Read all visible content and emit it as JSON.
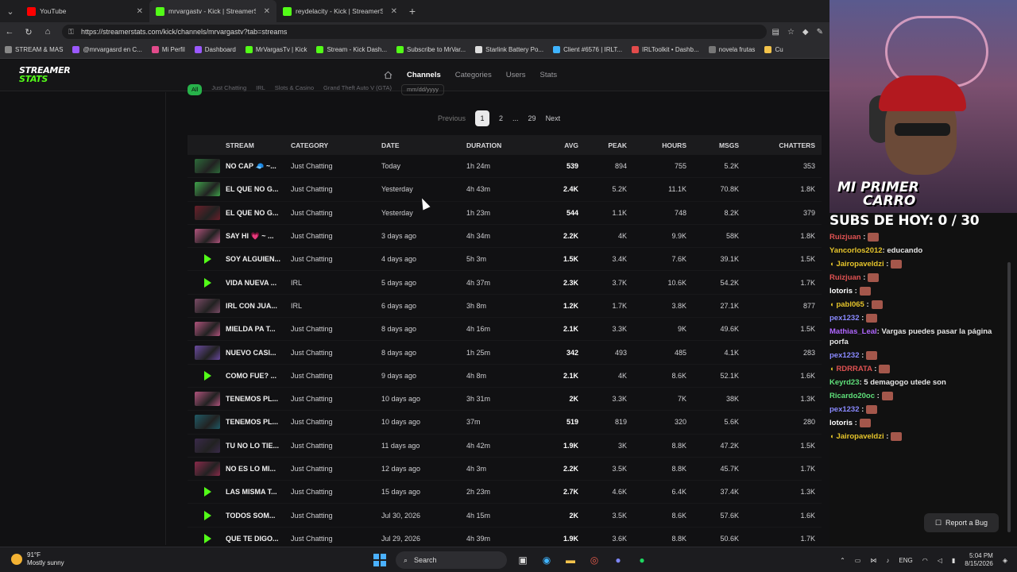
{
  "browser": {
    "tabs": [
      {
        "label": "YouTube",
        "fav_color": "#ff0000",
        "active": false
      },
      {
        "label": "mrvargastv - Kick | StreamerStats",
        "fav_color": "#53fc18",
        "active": true
      },
      {
        "label": "reydelacity - Kick | StreamerStats",
        "fav_color": "#53fc18",
        "active": false
      }
    ],
    "url": "https://streamerstats.com/kick/channels/mrvargastv?tab=streams",
    "bookmarks": [
      "STREAM & MAS",
      "@mrvargasrd en C...",
      "Mi Perfil",
      "Dashboard",
      "MrVargasTv | Kick",
      "Stream - Kick Dash...",
      "Subscribe to MrVar...",
      "Starlink Battery Po...",
      "Client #6576 | IRLT...",
      "IRLToolkit • Dashb...",
      "novela frutas",
      "Cu"
    ]
  },
  "site": {
    "logo_line1": "STREAMER",
    "logo_line2": "STATS",
    "nav": [
      "Channels",
      "Categories",
      "Users",
      "Stats"
    ],
    "filters": [
      "All",
      "Just Chatting",
      "IRL",
      "Slots & Casino",
      "Grand Theft Auto V (GTA)",
      "mm/dd/yyyy"
    ],
    "pagination": {
      "prev": "Previous",
      "pages": [
        "1",
        "2",
        "...",
        "29"
      ],
      "next": "Next"
    },
    "columns": [
      "STREAM",
      "CATEGORY",
      "DATE",
      "DURATION",
      "AVG",
      "PEAK",
      "HOURS",
      "MSGS",
      "CHATTERS"
    ],
    "rows": [
      {
        "name": "NO CAP 🧢 ~...",
        "category": "Just Chatting",
        "date": "Today",
        "duration": "1h 24m",
        "avg": "539",
        "peak": "894",
        "hours": "755",
        "msgs": "5.2K",
        "chatters": "353",
        "thumb": "img",
        "thumb_color": "#2d6b3a"
      },
      {
        "name": "EL QUE NO G...",
        "category": "Just Chatting",
        "date": "Yesterday",
        "duration": "4h 43m",
        "avg": "2.4K",
        "peak": "5.2K",
        "hours": "11.1K",
        "msgs": "70.8K",
        "chatters": "1.8K",
        "thumb": "img",
        "thumb_color": "#3fa24a"
      },
      {
        "name": "EL QUE NO G...",
        "category": "Just Chatting",
        "date": "Yesterday",
        "duration": "1h 23m",
        "avg": "544",
        "peak": "1.1K",
        "hours": "748",
        "msgs": "8.2K",
        "chatters": "379",
        "thumb": "img",
        "thumb_color": "#6b1f2a"
      },
      {
        "name": "SAY HI 💗 ~ ...",
        "category": "Just Chatting",
        "date": "3 days ago",
        "duration": "4h 34m",
        "avg": "2.2K",
        "peak": "4K",
        "hours": "9.9K",
        "msgs": "58K",
        "chatters": "1.8K",
        "thumb": "img",
        "thumb_color": "#b0537c"
      },
      {
        "name": "SOY ALGUIEN...",
        "category": "Just Chatting",
        "date": "4 days ago",
        "duration": "5h 3m",
        "avg": "1.5K",
        "peak": "3.4K",
        "hours": "7.6K",
        "msgs": "39.1K",
        "chatters": "1.5K",
        "thumb": "play"
      },
      {
        "name": "VIDA NUEVA ...",
        "category": "IRL",
        "date": "5 days ago",
        "duration": "4h 37m",
        "avg": "2.3K",
        "peak": "3.7K",
        "hours": "10.6K",
        "msgs": "54.2K",
        "chatters": "1.7K",
        "thumb": "play"
      },
      {
        "name": "IRL CON JUA...",
        "category": "IRL",
        "date": "6 days ago",
        "duration": "3h 8m",
        "avg": "1.2K",
        "peak": "1.7K",
        "hours": "3.8K",
        "msgs": "27.1K",
        "chatters": "877",
        "thumb": "img",
        "thumb_color": "#7a4b66"
      },
      {
        "name": "MIELDA PA T...",
        "category": "Just Chatting",
        "date": "8 days ago",
        "duration": "4h 16m",
        "avg": "2.1K",
        "peak": "3.3K",
        "hours": "9K",
        "msgs": "49.6K",
        "chatters": "1.5K",
        "thumb": "img",
        "thumb_color": "#b0537c"
      },
      {
        "name": "NUEVO CASI...",
        "category": "Just Chatting",
        "date": "8 days ago",
        "duration": "1h 25m",
        "avg": "342",
        "peak": "493",
        "hours": "485",
        "msgs": "4.1K",
        "chatters": "283",
        "thumb": "img",
        "thumb_color": "#6a4aa0"
      },
      {
        "name": "COMO FUE? ...",
        "category": "Just Chatting",
        "date": "9 days ago",
        "duration": "4h 8m",
        "avg": "2.1K",
        "peak": "4K",
        "hours": "8.6K",
        "msgs": "52.1K",
        "chatters": "1.6K",
        "thumb": "play"
      },
      {
        "name": "TENEMOS PL...",
        "category": "Just Chatting",
        "date": "10 days ago",
        "duration": "3h 31m",
        "avg": "2K",
        "peak": "3.3K",
        "hours": "7K",
        "msgs": "38K",
        "chatters": "1.3K",
        "thumb": "img",
        "thumb_color": "#b0537c"
      },
      {
        "name": "TENEMOS PL...",
        "category": "Just Chatting",
        "date": "10 days ago",
        "duration": "37m",
        "avg": "519",
        "peak": "819",
        "hours": "320",
        "msgs": "5.6K",
        "chatters": "280",
        "thumb": "img",
        "thumb_color": "#1f5a66"
      },
      {
        "name": "TU NO LO TIE...",
        "category": "Just Chatting",
        "date": "11 days ago",
        "duration": "4h 42m",
        "avg": "1.9K",
        "peak": "3K",
        "hours": "8.8K",
        "msgs": "47.2K",
        "chatters": "1.5K",
        "thumb": "img",
        "thumb_color": "#3a2a4a"
      },
      {
        "name": "NO ES LO MI...",
        "category": "Just Chatting",
        "date": "12 days ago",
        "duration": "4h 3m",
        "avg": "2.2K",
        "peak": "3.5K",
        "hours": "8.8K",
        "msgs": "45.7K",
        "chatters": "1.7K",
        "thumb": "img",
        "thumb_color": "#8a2a4a"
      },
      {
        "name": "LAS MISMA T...",
        "category": "Just Chatting",
        "date": "15 days ago",
        "duration": "2h 23m",
        "avg": "2.7K",
        "peak": "4.6K",
        "hours": "6.4K",
        "msgs": "37.4K",
        "chatters": "1.3K",
        "thumb": "play"
      },
      {
        "name": "TODOS SOM...",
        "category": "Just Chatting",
        "date": "Jul 30, 2026",
        "duration": "4h 15m",
        "avg": "2K",
        "peak": "3.5K",
        "hours": "8.6K",
        "msgs": "57.6K",
        "chatters": "1.6K",
        "thumb": "play"
      },
      {
        "name": "QUE TE DIGO...",
        "category": "Just Chatting",
        "date": "Jul 29, 2026",
        "duration": "4h 39m",
        "avg": "1.9K",
        "peak": "3.6K",
        "hours": "8.8K",
        "msgs": "50.6K",
        "chatters": "1.7K",
        "thumb": "play"
      }
    ],
    "report_label": "Report a Bug"
  },
  "overlay": {
    "cam_banner_line1": "MI PRIMER",
    "cam_banner_line2": "CARRO",
    "subs_text": "SUBS DE HOY: 0 / 30",
    "chat": [
      {
        "user": "Ruizjuan",
        "color": "#e05252",
        "text": "",
        "badge": false,
        "emote": true
      },
      {
        "user": "Yancorlos2012",
        "color": "#e5c42b",
        "text": ": educando",
        "badge": false,
        "emote": false
      },
      {
        "user": "Jairopaveldzi",
        "color": "#e5c42b",
        "text": "",
        "badge": true,
        "emote": true
      },
      {
        "user": "Ruizjuan",
        "color": "#e05252",
        "text": "",
        "badge": false,
        "emote": true
      },
      {
        "user": "lotoris",
        "color": "#ffffff",
        "text": "",
        "badge": false,
        "emote": true
      },
      {
        "user": "pabl065",
        "color": "#e5c42b",
        "text": "",
        "badge": true,
        "emote": true
      },
      {
        "user": "pex1232",
        "color": "#8a8aff",
        "text": "",
        "badge": false,
        "emote": true
      },
      {
        "user": "Mathias_Leal",
        "color": "#b066ff",
        "text": ": Vargas puedes pasar la página porfa",
        "badge": false,
        "emote": false
      },
      {
        "user": "pex1232",
        "color": "#8a8aff",
        "text": "",
        "badge": false,
        "emote": true
      },
      {
        "user": "RDRRATA",
        "color": "#e05252",
        "text": "",
        "badge": true,
        "emote": true
      },
      {
        "user": "Keyrd23",
        "color": "#5fe07a",
        "text": ": 5 demagogo utede son",
        "badge": false,
        "emote": false
      },
      {
        "user": "Ricardo20oc",
        "color": "#5fe07a",
        "text": "",
        "badge": false,
        "emote": true
      },
      {
        "user": "pex1232",
        "color": "#8a8aff",
        "text": "",
        "badge": false,
        "emote": true
      },
      {
        "user": "lotoris",
        "color": "#ffffff",
        "text": "",
        "badge": false,
        "emote": true
      },
      {
        "user": "Jairopaveldzi",
        "color": "#e5c42b",
        "text": "",
        "badge": true,
        "emote": true
      }
    ]
  },
  "taskbar": {
    "temp": "91°F",
    "weather": "Mostly sunny",
    "search_label": "Search",
    "lang": "ENG",
    "time": "5:04 PM",
    "date": "8/15/2026"
  }
}
